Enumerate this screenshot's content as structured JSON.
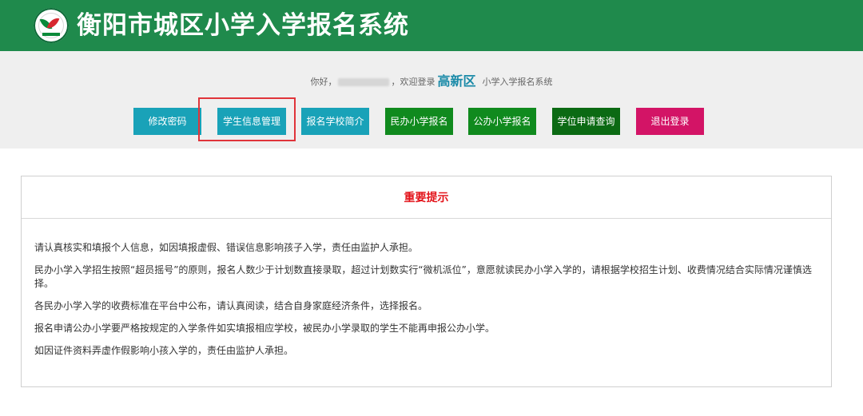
{
  "header": {
    "title": "衡阳市城区小学入学报名系统",
    "logo_icon": "school-emblem-icon",
    "background": "#1f8a4c"
  },
  "welcome": {
    "greeting": "你好，",
    "suffix": "，欢迎登录",
    "district": "高新区",
    "system_name": "小学入学报名系统"
  },
  "nav": {
    "change_password": "修改密码",
    "student_info": "学生信息管理",
    "school_intro": "报名学校简介",
    "private_school_apply": "民办小学报名",
    "public_school_apply": "公办小学报名",
    "seat_query": "学位申请查询",
    "logout": "退出登录"
  },
  "notice": {
    "title": "重要提示",
    "items": [
      "请认真核实和填报个人信息，如因填报虚假、错误信息影响孩子入学，责任由监护人承担。",
      "民办小学入学招生按照“超员摇号”的原则，报名人数少于计划数直接录取，超过计划数实行“微机派位”，意愿就读民办小学入学的，请根据学校招生计划、收费情况结合实际情况谨慎选择。",
      "各民办小学入学的收费标准在平台中公布，请认真阅读，结合自身家庭经济条件，选择报名。",
      "报名申请公办小学要严格按规定的入学条件如实填报相应学校，被民办小学录取的学生不能再申报公办小学。",
      "如因证件资料弄虚作假影响小孩入学的，责任由监护人承担。"
    ]
  },
  "colors": {
    "teal_button": "#19a2b8",
    "green_button": "#108a1e",
    "dark_green_button": "#0b6a13",
    "logout_button": "#d31466",
    "notice_title": "#e3141b",
    "highlight_border": "#e0343a"
  }
}
